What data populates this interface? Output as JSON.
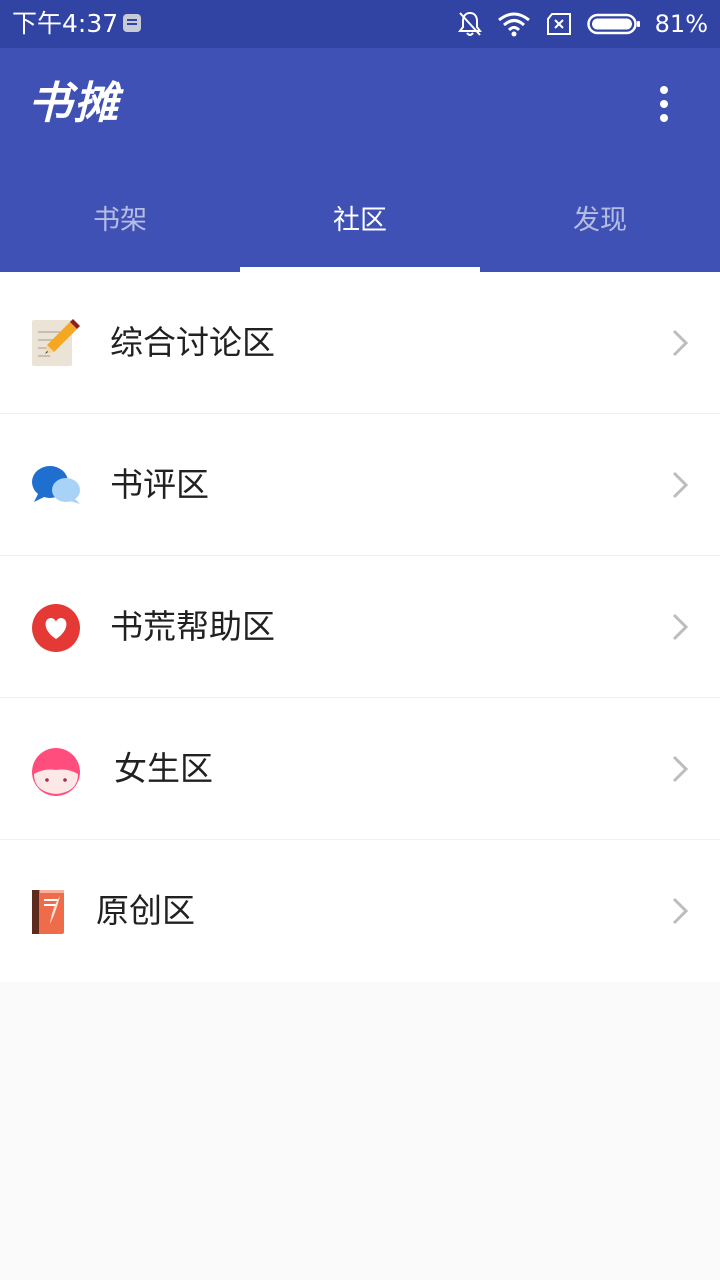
{
  "status_bar": {
    "time": "下午4:37",
    "battery": "81%",
    "icons": [
      "message-icon",
      "bell-off-icon",
      "wifi-icon",
      "no-sim-icon",
      "battery-icon"
    ]
  },
  "app_bar": {
    "title": "书摊",
    "menu_icon": "more-vert-icon"
  },
  "tabs": [
    {
      "label": "书架",
      "active": false
    },
    {
      "label": "社区",
      "active": true
    },
    {
      "label": "发现",
      "active": false
    }
  ],
  "community": [
    {
      "label": "综合讨论区",
      "icon": "notepad-pencil-icon"
    },
    {
      "label": "书评区",
      "icon": "chat-bubbles-icon"
    },
    {
      "label": "书荒帮助区",
      "icon": "heart-circle-icon"
    },
    {
      "label": "女生区",
      "icon": "girl-face-icon"
    },
    {
      "label": "原创区",
      "icon": "book-quill-icon"
    }
  ],
  "colors": {
    "status_bar": "#3143a3",
    "primary": "#3f51b5",
    "background": "#fafafa"
  }
}
